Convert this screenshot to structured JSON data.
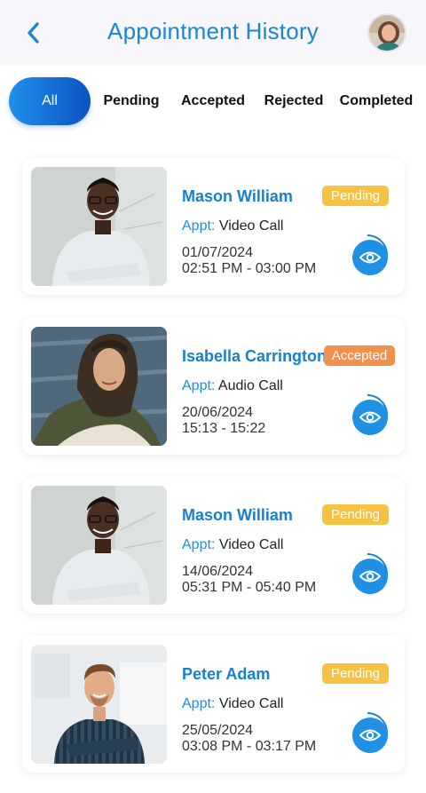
{
  "header": {
    "title": "Appointment History",
    "back_icon": "chevron-left-icon"
  },
  "colors": {
    "accent": "#1787d6",
    "pending": "#f6c244",
    "accepted": "#f2914c",
    "tab_active_start": "#1f8fea",
    "tab_active_end": "#0a53c2"
  },
  "tabs": [
    {
      "label": "All",
      "active": true
    },
    {
      "label": "Pending",
      "active": false
    },
    {
      "label": "Accepted",
      "active": false
    },
    {
      "label": "Rejected",
      "active": false
    },
    {
      "label": "Completed",
      "active": false
    }
  ],
  "appointments": [
    {
      "name": "Mason William",
      "status": "Pending",
      "appt_label": "Appt:",
      "appt_type": "Video Call",
      "date": "01/07/2024",
      "time": "02:51 PM - 03:00 PM"
    },
    {
      "name": "Isabella Carrington",
      "status": "Accepted",
      "appt_label": "Appt:",
      "appt_type": "Audio Call",
      "date": "20/06/2024",
      "time": "15:13 - 15:22"
    },
    {
      "name": "Mason William",
      "status": "Pending",
      "appt_label": "Appt:",
      "appt_type": "Video Call",
      "date": "14/06/2024",
      "time": "05:31 PM - 05:40 PM"
    },
    {
      "name": "Peter Adam",
      "status": "Pending",
      "appt_label": "Appt:",
      "appt_type": "Video Call",
      "date": "25/05/2024",
      "time": "03:08 PM - 03:17 PM"
    }
  ]
}
